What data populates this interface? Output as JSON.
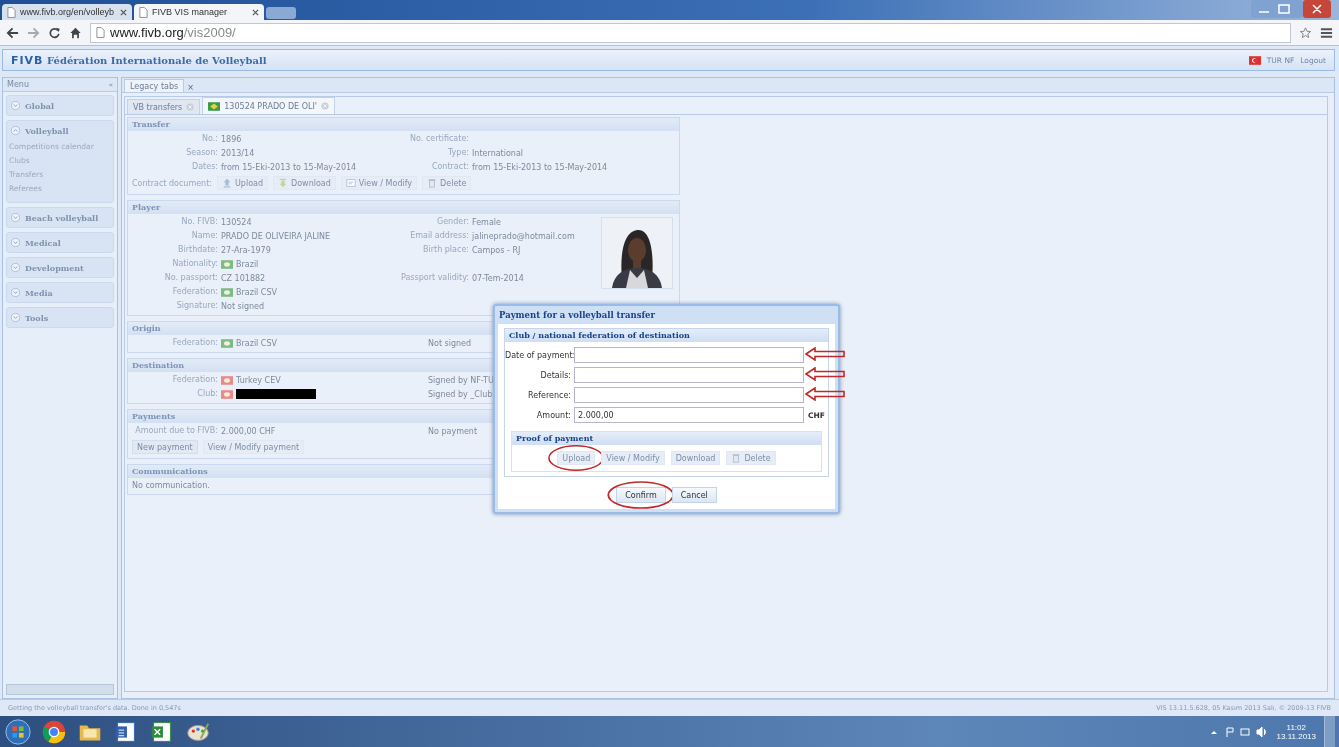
{
  "browser": {
    "tabs": [
      {
        "title": "www.fivb.org/en/volleyb",
        "selected": false
      },
      {
        "title": "FIVB VIS manager",
        "selected": true
      }
    ],
    "url_host": "www.fivb.org",
    "url_path": "/vis2009/"
  },
  "app": {
    "logo": "FIVB",
    "title": "Fédération Internationale de Volleyball",
    "user": "TUR NF",
    "logout": "Logout"
  },
  "menu": {
    "title": "Menu",
    "collapse": "«",
    "groups": [
      {
        "label": "Global",
        "expanded": false
      },
      {
        "label": "Volleyball",
        "expanded": true,
        "items": [
          "Competitions calendar",
          "Clubs",
          "Transfers",
          "Referees"
        ]
      },
      {
        "label": "Beach volleyball",
        "expanded": false
      },
      {
        "label": "Medical",
        "expanded": false
      },
      {
        "label": "Development",
        "expanded": false
      },
      {
        "label": "Media",
        "expanded": false
      },
      {
        "label": "Tools",
        "expanded": false
      }
    ]
  },
  "legacy_tab": {
    "label": "Legacy tabs",
    "close": "×"
  },
  "tabs": [
    {
      "label": "VB transfers",
      "selected": false
    },
    {
      "label": "130524 PRADO DE OLI'",
      "selected": true,
      "color": "#3c9a4a"
    }
  ],
  "sections": [
    {
      "title": "Transfer",
      "rows": [
        [
          {
            "label": "No.:",
            "value": "1896"
          },
          {
            "label": "No. certificate:"
          }
        ],
        [
          {
            "label": "Season:",
            "value": "2013/14"
          },
          {
            "label": "Type:",
            "value": "International"
          }
        ],
        [
          {
            "label": "Dates:",
            "value": "from 15-Eki-2013  to 15-May-2014"
          },
          {
            "label": "Contract:",
            "value": "from 15-Eki-2013  to 15-May-2014"
          }
        ]
      ],
      "actions_label": "Contract document:",
      "actions": [
        {
          "label": "Upload",
          "kind": "upload",
          "disabled": true
        },
        {
          "label": "Download",
          "kind": "download",
          "disabled": true
        },
        {
          "label": "View / Modify",
          "kind": "edit",
          "disabled": true
        },
        {
          "label": "Delete",
          "kind": "delete",
          "disabled": true
        }
      ]
    },
    {
      "title": "Player",
      "photo": {
        "kind": "picture"
      },
      "rows": [
        [
          {
            "label": "No. FIVB:",
            "value": "130524"
          },
          {
            "label": "Gender:",
            "value": "Female"
          }
        ],
        [
          {
            "label": "Name:",
            "value": "PRADO DE OLIVEIRA JALINE"
          },
          {
            "label": "Email address:",
            "value": "jalineprado@hotmail.com"
          }
        ],
        [
          {
            "label": "Birthdate:",
            "value": "27-Ara-1979"
          },
          {
            "label": "Birth place:",
            "value": "Campos - RJ"
          }
        ],
        [
          {
            "label": "Nationality:",
            "value": "Brazil",
            "color": "#7dbb86"
          }
        ],
        [
          {
            "label": "No. passport:",
            "value": "CZ 101882"
          },
          {
            "label": "Passport validity:",
            "value": "07-Tem-2014"
          }
        ],
        [
          {
            "label": "Federation:",
            "value": "Brazil   CSV",
            "color": "#7dbb86"
          }
        ],
        [
          {
            "label": "Signature:",
            "value": "Not signed"
          }
        ]
      ]
    },
    {
      "title": "Origin",
      "rows": [
        [
          {
            "label": "Federation:",
            "value": "Brazil   CSV",
            "color": "#7dbb86"
          },
          {
            "value": "Not signed"
          }
        ]
      ]
    },
    {
      "title": "Destination",
      "rows": [
        [
          {
            "label": "Federation:",
            "value": "Turkey   CEV",
            "color": "#e88a8a"
          },
          {
            "value": "Signed by NF-TU"
          }
        ],
        [
          {
            "label": "Club:",
            "color": "#e88a8a",
            "redacted": true
          },
          {
            "value": "Signed by _Club"
          }
        ]
      ]
    },
    {
      "title": "Payments",
      "rows": [
        [
          {
            "label": "Amount due to FIVB:",
            "value": "2.000,00 CHF"
          },
          {
            "value": "No payment"
          }
        ]
      ],
      "actions": [
        {
          "label": "New payment",
          "disabled": false
        },
        {
          "label": "View / Modify payment",
          "disabled": true
        }
      ]
    },
    {
      "title": "Communications",
      "text": "No communication."
    }
  ],
  "dialog": {
    "title": "Payment for a volleyball transfer",
    "section": "Club / national federation of destination",
    "fields": [
      {
        "label": "Date of payment:",
        "marked": true
      },
      {
        "label": "Details:",
        "marked": true
      },
      {
        "label": "Reference:",
        "marked": true
      },
      {
        "label": "Amount:",
        "value": "2.000,00",
        "unit": "CHF",
        "marked": false
      }
    ],
    "proof_title": "Proof of payment",
    "proof_buttons": [
      {
        "label": "Upload",
        "disabled": true,
        "circled": true
      },
      {
        "label": "View / Modify",
        "disabled": true,
        "circled": false
      },
      {
        "label": "Download",
        "disabled": true,
        "circled": false
      },
      {
        "label": "Delete",
        "kind": "delete",
        "disabled": true,
        "circled": false
      }
    ],
    "buttons": [
      {
        "label": "Confirm",
        "circled": true
      },
      {
        "label": "Cancel",
        "circled": false
      }
    ]
  },
  "status_bar": {
    "left": "Getting the volleyball transfer's data. Done in 0,547s",
    "right": "VIS 13.11.5.628, 05 Kasım 2013 Salı, © 2009-13 FIVB"
  },
  "taskbar": {
    "time": "11:02",
    "date": "13.11.2013"
  }
}
